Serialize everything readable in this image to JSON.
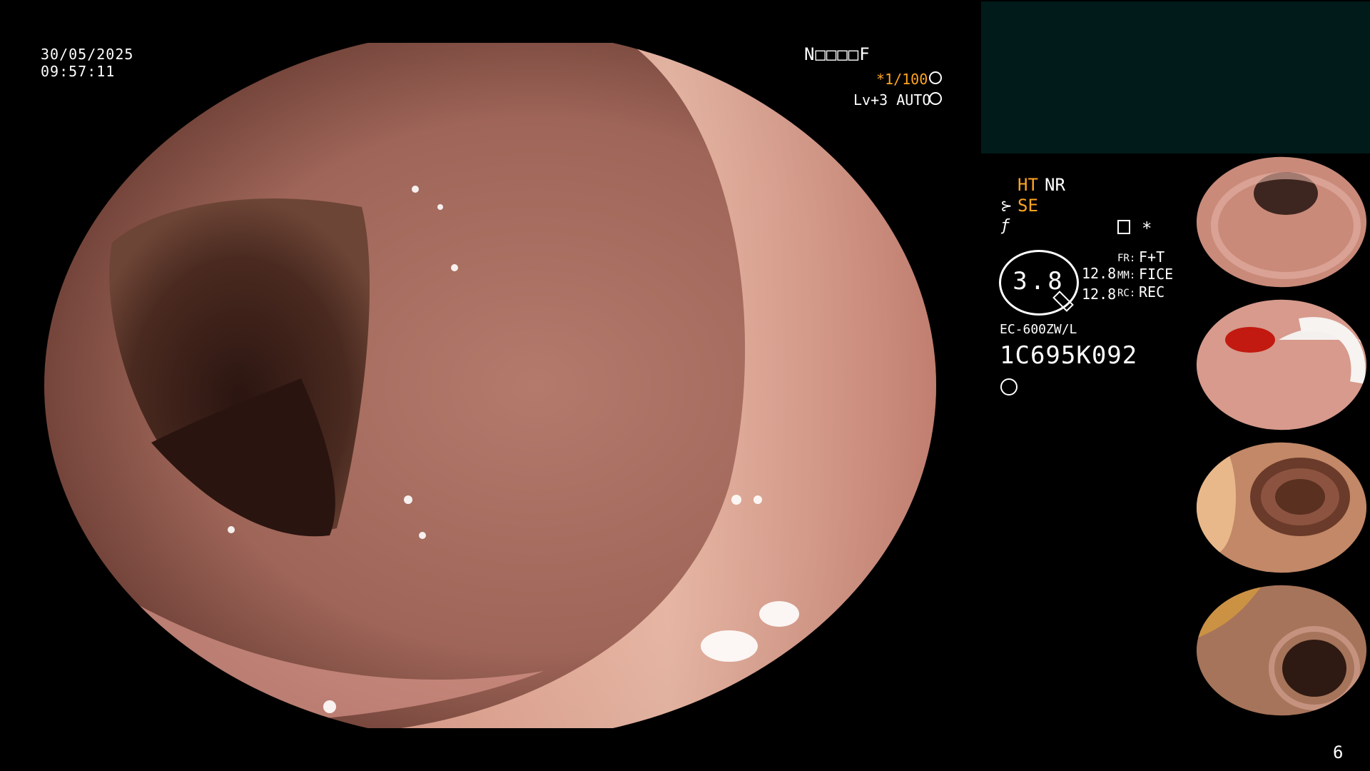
{
  "overlay": {
    "date": "30/05/2025",
    "time": "09:57:11",
    "code": "N□□□□F",
    "shutter": "*1/100",
    "level": "Lv+3 AUTO",
    "shutter_icon": "aperture-icon",
    "auto_icon": "auto-iris-icon"
  },
  "info": {
    "ht": "HT",
    "nr": "NR",
    "se": "SE",
    "se_icon": "contour-icon",
    "color_icon": "color-adjust-icon",
    "memo_icon": "memo-icon",
    "star": "*",
    "zoom": "3.8",
    "fr_label": "FR:",
    "fr_value": "F+T",
    "mm_label": "MM:",
    "mm_value": "FICE",
    "rc_label": "RC:",
    "rc_value": "REC",
    "val1": "12.8",
    "val2": "12.8",
    "scope_model": "EC-600ZW/L",
    "serial": "1C695K092",
    "light_icon": "light-source-icon"
  },
  "page_number": "6",
  "thumbnails": [
    {
      "name": "thumb-1",
      "color": "#c98a7a"
    },
    {
      "name": "thumb-2",
      "color": "#d79a8c"
    },
    {
      "name": "thumb-3",
      "color": "#c28867"
    },
    {
      "name": "thumb-4",
      "color": "#a6745a"
    }
  ]
}
